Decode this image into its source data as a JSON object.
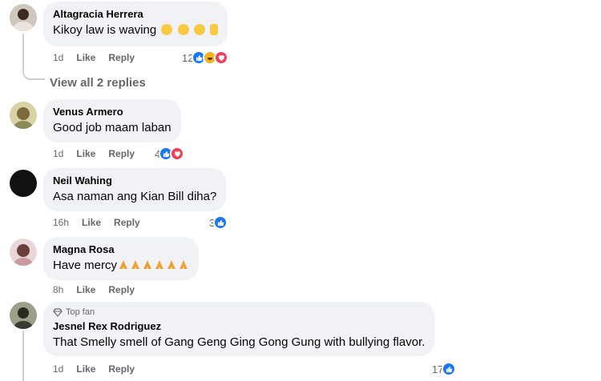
{
  "comments": [
    {
      "author": "Altagracia Herrera",
      "text": "Kikoy law is waving",
      "time": "1d",
      "like": "Like",
      "reply": "Reply",
      "reaction_count": "12",
      "reactions": [
        "like",
        "haha",
        "love"
      ]
    },
    {
      "author": "Venus Armero",
      "text": "Good job maam laban",
      "time": "1d",
      "like": "Like",
      "reply": "Reply",
      "reaction_count": "4",
      "reactions": [
        "like",
        "love"
      ]
    },
    {
      "author": "Neil Wahing",
      "text": "Asa naman ang Kian Bill diha?",
      "time": "16h",
      "like": "Like",
      "reply": "Reply",
      "reaction_count": "3",
      "reactions": [
        "like"
      ]
    },
    {
      "author": "Magna Rosa",
      "text": "Have mercy",
      "time": "8h",
      "like": "Like",
      "reply": "Reply",
      "reaction_count": "",
      "reactions": []
    },
    {
      "badge": "Top fan",
      "author": "Jesnel Rex Rodriguez",
      "text": "That Smelly smell of Gang Geng Ging Gong Gung with bullying flavor.",
      "time": "1d",
      "like": "Like",
      "reply": "Reply",
      "reaction_count": "17",
      "reactions": [
        "like"
      ]
    }
  ],
  "view_replies": "View all 2 replies",
  "colors": {
    "bubble": "#f0f2f5",
    "meta": "#65676b",
    "like": "#1877f2",
    "love": "#f33e58",
    "haha": "#f7b125"
  }
}
